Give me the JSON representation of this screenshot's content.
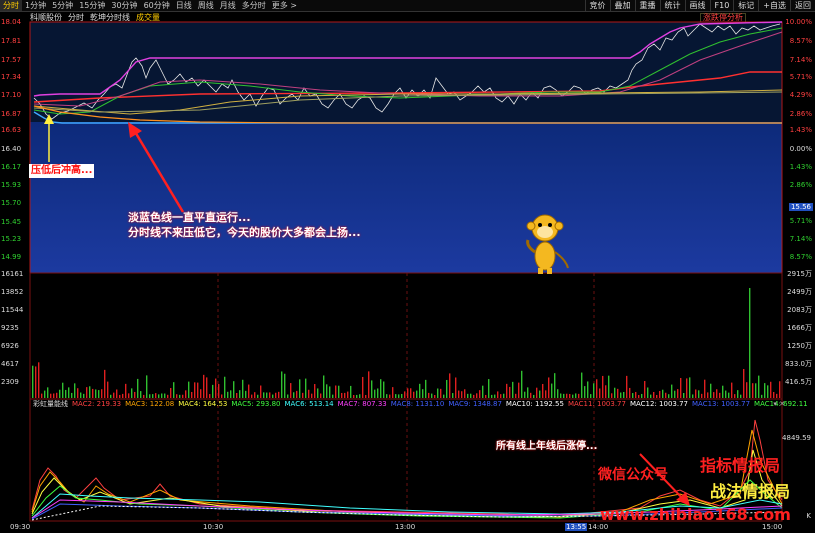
{
  "toolbar": {
    "periods": [
      "分时",
      "1分钟",
      "5分钟",
      "15分钟",
      "30分钟",
      "60分钟",
      "日线",
      "周线",
      "月线",
      "多分时",
      "更多 >"
    ],
    "right_buttons": [
      "竞价",
      "叠加",
      "重播",
      "统计",
      "画线",
      "F10",
      "标记",
      "+自选",
      "返回"
    ]
  },
  "price_panel": {
    "stock_name": "科顺股份",
    "tabs": [
      "分时",
      "乾坤分时线",
      "成交量"
    ],
    "indicator_label": "涨跌停分析",
    "y_left": [
      "18.04",
      "17.81",
      "17.57",
      "17.34",
      "17.10",
      "16.87",
      "16.63",
      "16.40",
      "16.17",
      "15.93",
      "15.70",
      "15.45",
      "15.23",
      "14.99"
    ],
    "y_right": [
      "10.00%",
      "8.57%",
      "7.14%",
      "5.71%",
      "4.29%",
      "2.86%",
      "1.43%",
      "0.00%",
      "1.43%",
      "2.86%",
      "4.29%",
      "5.71%",
      "7.14%",
      "8.57%"
    ],
    "current_price_tag": "15.56",
    "colors": {
      "upper_band": "#061633",
      "lower_band": "#1c3aa0",
      "border": "#b01818"
    }
  },
  "volume_panel": {
    "y_left": [
      "16161",
      "13852",
      "11544",
      "9235",
      "6926",
      "4617",
      "2309"
    ],
    "y_right": [
      "2915万",
      "2499万",
      "2083万",
      "1666万",
      "1250万",
      "833.0万",
      "416.5万"
    ]
  },
  "rainbow_panel": {
    "name": "彩虹量能线",
    "values": [
      {
        "label": "MAC2: 219.33",
        "color": "#ff4040"
      },
      {
        "label": "MAC3: 122.08",
        "color": "#ffa500"
      },
      {
        "label": "MAC4: 164.53",
        "color": "#ffff40"
      },
      {
        "label": "MAC5: 293.80",
        "color": "#40ff40"
      },
      {
        "label": "MAC6: 513.14",
        "color": "#40ffff"
      },
      {
        "label": "MAC7: 807.33",
        "color": "#ff40ff"
      },
      {
        "label": "MAC8: 1131.10",
        "color": "#4060ff"
      },
      {
        "label": "MAC9: 1348.87",
        "color": "#4060ff"
      },
      {
        "label": "MAC10: 1192.55",
        "color": "#ffffff"
      },
      {
        "label": "MAC11: 1003.77",
        "color": "#ff4040"
      },
      {
        "label": "MAC12: 1003.77",
        "color": "#ffffff"
      },
      {
        "label": "MAC13: 1003.77",
        "color": "#4060ff"
      },
      {
        "label": "MAC14: 692.11",
        "color": "#40ff40"
      }
    ],
    "y_right": [
      "4849.59",
      "K"
    ]
  },
  "time_axis": {
    "labels": [
      "09:30",
      "10:30",
      "13:00",
      "13:55",
      "14:00",
      "15:00"
    ]
  },
  "annotations": {
    "a1": "压低后冲高...",
    "a2_line1": "淡蓝色线一直平直运行...",
    "a2_line2": "分时线不来压低它，今天的股价大多都会上扬...",
    "a3": "所有线上年线后涨停..."
  },
  "watermark": {
    "line1": "指标情报局",
    "line2": "战法情报局",
    "wechat": "微信公众号",
    "url": "www.zhibiao168.com"
  }
}
